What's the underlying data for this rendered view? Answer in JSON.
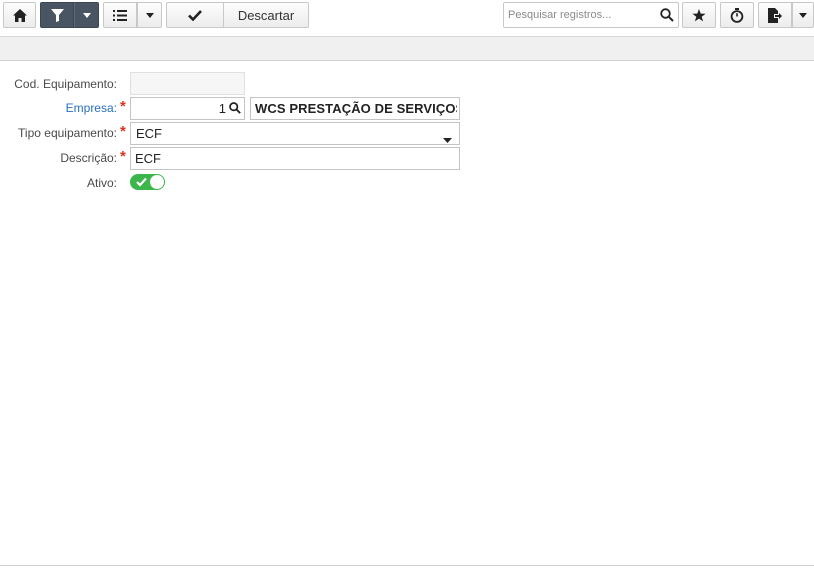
{
  "toolbar": {
    "home_icon": "home-icon",
    "filter_icon": "filter-icon",
    "list_icon": "list-icon",
    "confirm_icon": "check-icon",
    "discard_label": "Descartar",
    "search_placeholder": "Pesquisar registros...",
    "star_icon": "star-icon",
    "timer_icon": "stopwatch-icon",
    "export_icon": "document-export-icon",
    "colors": {
      "filter_button_bg": "#4a5563"
    }
  },
  "form": {
    "cod_equipamento": {
      "label": "Cod. Equipamento:",
      "value": ""
    },
    "empresa": {
      "label": "Empresa:",
      "required_mark": "*",
      "code": "1",
      "name": "WCS PRESTAÇÃO DE SERVIÇOS"
    },
    "tipo_equipamento": {
      "label": "Tipo equipamento:",
      "required_mark": "*",
      "value": "ECF"
    },
    "descricao": {
      "label": "Descrição:",
      "required_mark": "*",
      "value": "ECF"
    },
    "ativo": {
      "label": "Ativo:",
      "checked": true,
      "color": "#3cb54a"
    }
  }
}
